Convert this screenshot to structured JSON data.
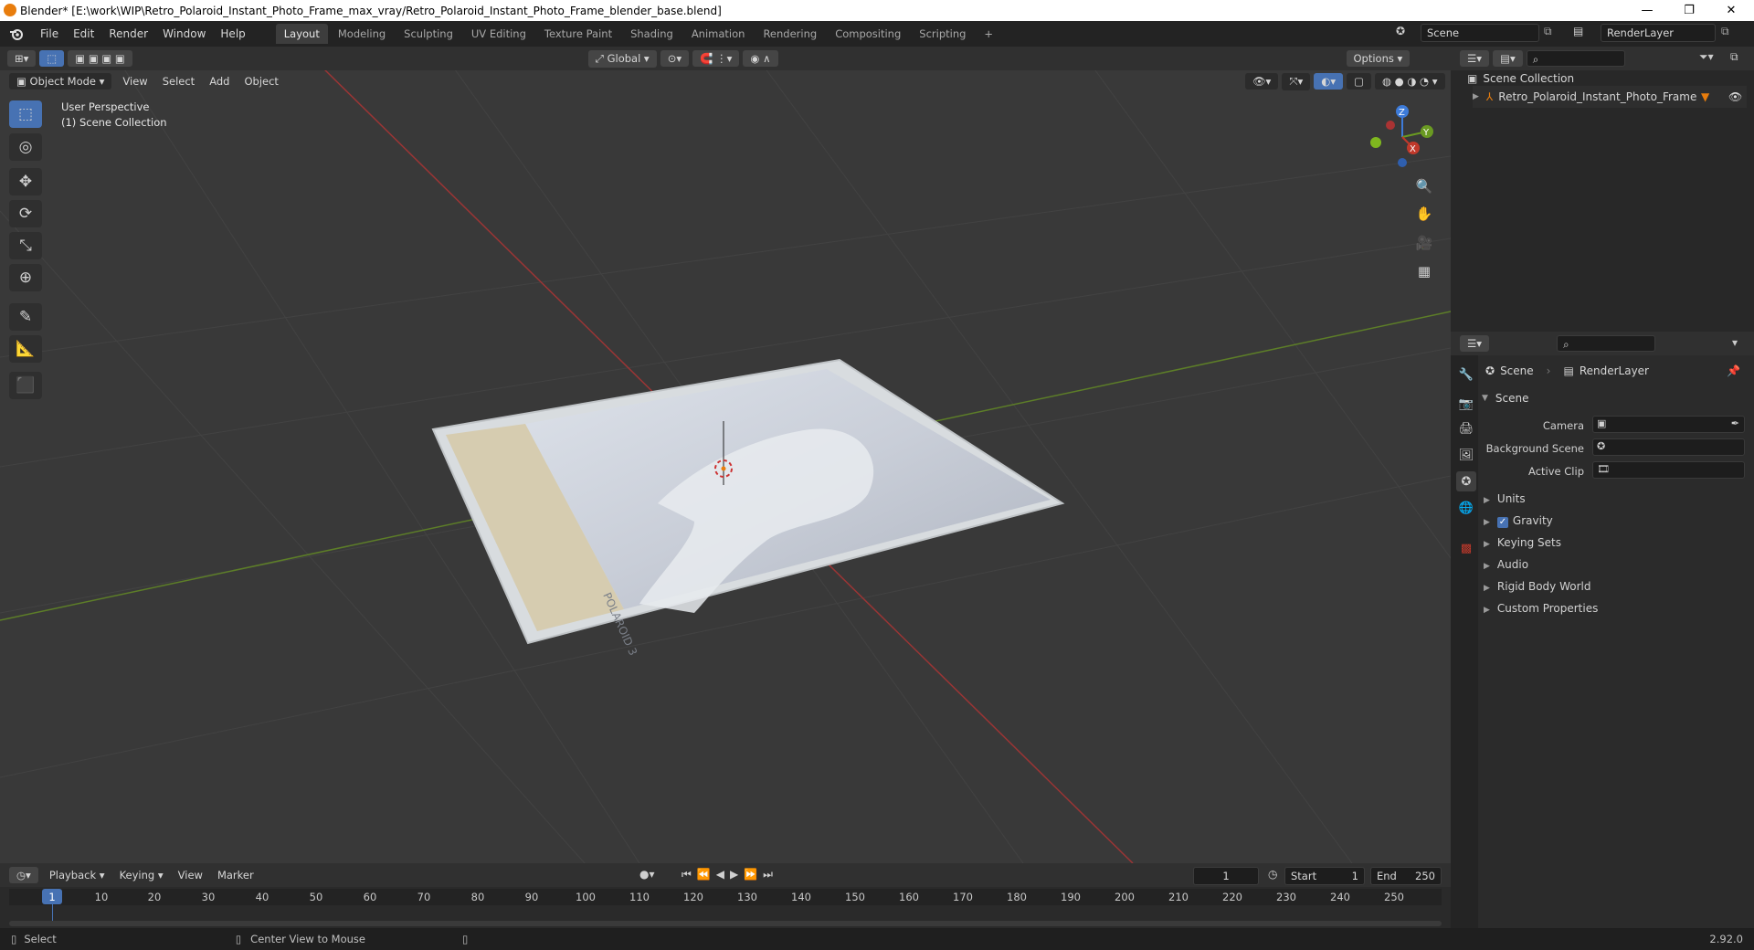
{
  "window": {
    "title": "Blender* [E:\\work\\WIP\\Retro_Polaroid_Instant_Photo_Frame_max_vray/Retro_Polaroid_Instant_Photo_Frame_blender_base.blend]",
    "minimize": "—",
    "maximize": "❐",
    "close": "✕"
  },
  "menu": [
    "File",
    "Edit",
    "Render",
    "Window",
    "Help"
  ],
  "workspaces": [
    "Layout",
    "Modeling",
    "Sculpting",
    "UV Editing",
    "Texture Paint",
    "Shading",
    "Animation",
    "Rendering",
    "Compositing",
    "Scripting"
  ],
  "workspace_add": "+",
  "scene_selector": {
    "scene": "Scene",
    "view_layer": "RenderLayer"
  },
  "viewport": {
    "mode": "Object Mode",
    "menus": [
      "View",
      "Select",
      "Add",
      "Object"
    ],
    "transform_orientation": "Global",
    "options": "Options",
    "overlay_line1": "User Perspective",
    "overlay_line2": "(1) Scene Collection",
    "gizmo": {
      "z": "Z",
      "y": "Y",
      "x": "X"
    },
    "photo_text": "POLAROID 3"
  },
  "outliner": {
    "root": "Scene Collection",
    "items": [
      {
        "name": "Retro_Polaroid_Instant_Photo_Frame"
      }
    ]
  },
  "properties": {
    "breadcrumb": [
      "Scene",
      "RenderLayer"
    ],
    "section": "Scene",
    "fields": [
      {
        "label": "Camera",
        "value": ""
      },
      {
        "label": "Background Scene",
        "value": ""
      },
      {
        "label": "Active Clip",
        "value": ""
      }
    ],
    "subpanels": [
      {
        "label": "Units",
        "checkbox": false
      },
      {
        "label": "Gravity",
        "checkbox": true,
        "checked": true
      },
      {
        "label": "Keying Sets",
        "checkbox": false
      },
      {
        "label": "Audio",
        "checkbox": false
      },
      {
        "label": "Rigid Body World",
        "checkbox": false
      },
      {
        "label": "Custom Properties",
        "checkbox": false
      }
    ]
  },
  "timeline": {
    "menus": [
      "Playback",
      "Keying",
      "View",
      "Marker"
    ],
    "current_frame": "1",
    "start_label": "Start",
    "start": "1",
    "end_label": "End",
    "end": "250",
    "ticks": [
      "1",
      "10",
      "20",
      "30",
      "40",
      "50",
      "60",
      "70",
      "80",
      "90",
      "100",
      "110",
      "120",
      "130",
      "140",
      "150",
      "160",
      "170",
      "180",
      "190",
      "200",
      "210",
      "220",
      "230",
      "240",
      "250"
    ]
  },
  "statusbar": {
    "select": "Select",
    "center_view": "Center View to Mouse",
    "version": "2.92.0"
  },
  "colors": {
    "accent": "#4772b3",
    "x_axis": "#c0392b",
    "y_axis": "#6a9a22",
    "z_axis": "#3d7bd9",
    "object_orange": "#e87d0d"
  }
}
